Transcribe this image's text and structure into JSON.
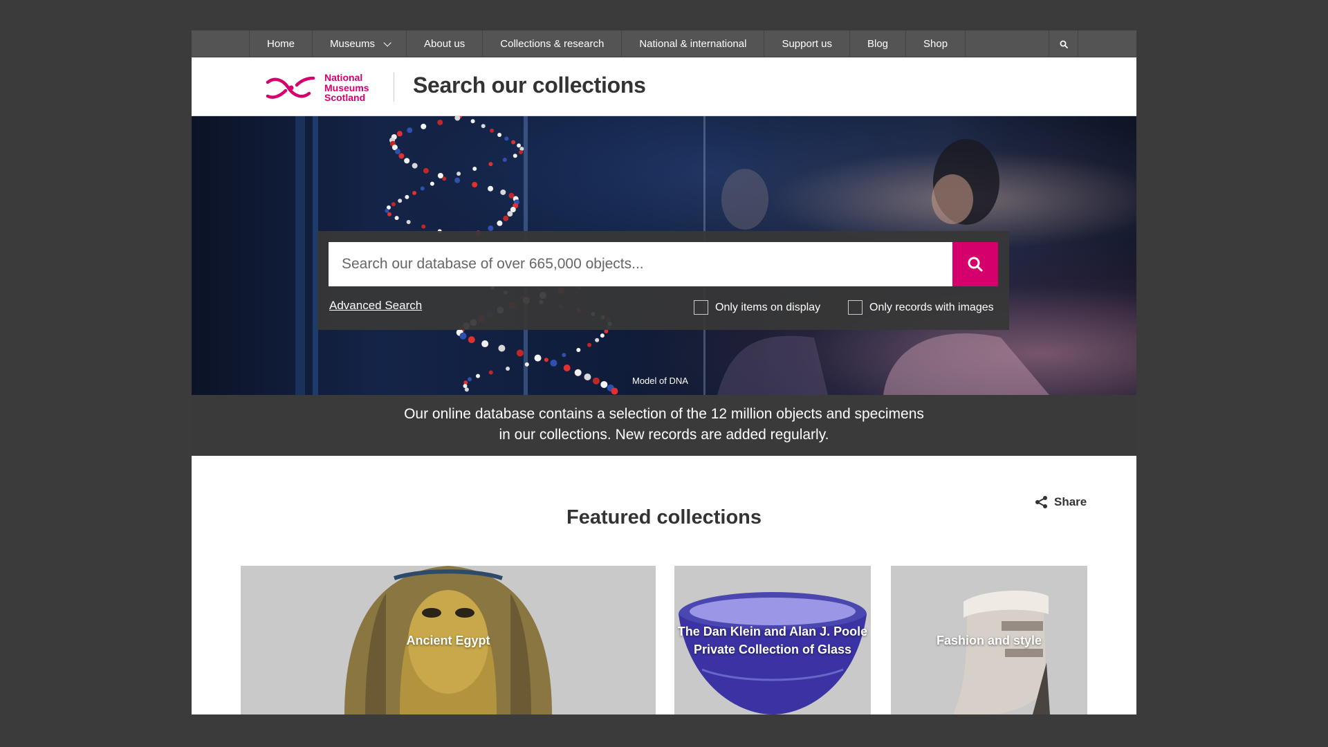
{
  "nav": {
    "items": [
      {
        "label": "Home"
      },
      {
        "label": "Museums",
        "dropdown": true
      },
      {
        "label": "About us"
      },
      {
        "label": "Collections & research"
      },
      {
        "label": "National & international"
      },
      {
        "label": "Support us"
      },
      {
        "label": "Blog"
      },
      {
        "label": "Shop"
      }
    ],
    "search_icon": "search-icon"
  },
  "header": {
    "logo_lines": [
      "National",
      "Museums",
      "Scotland"
    ],
    "title": "Search our collections",
    "brand_color": "#d6006d"
  },
  "hero": {
    "caption": "Model of DNA",
    "search": {
      "placeholder": "Search our database of over 665,000 objects...",
      "advanced_label": "Advanced Search",
      "filter_display": "Only items on display",
      "filter_images": "Only records with images",
      "filter_display_checked": false,
      "filter_images_checked": false
    }
  },
  "info": {
    "line1": "Our online database contains a selection of the 12 million objects and specimens",
    "line2": "in our collections. New records are added regularly."
  },
  "featured": {
    "title": "Featured collections",
    "share_label": "Share",
    "cards": [
      {
        "label": "Ancient Egypt"
      },
      {
        "label_line1": "The Dan Klein and Alan J. Poole",
        "label_line2": "Private Collection of Glass"
      },
      {
        "label": "Fashion and style"
      }
    ]
  }
}
